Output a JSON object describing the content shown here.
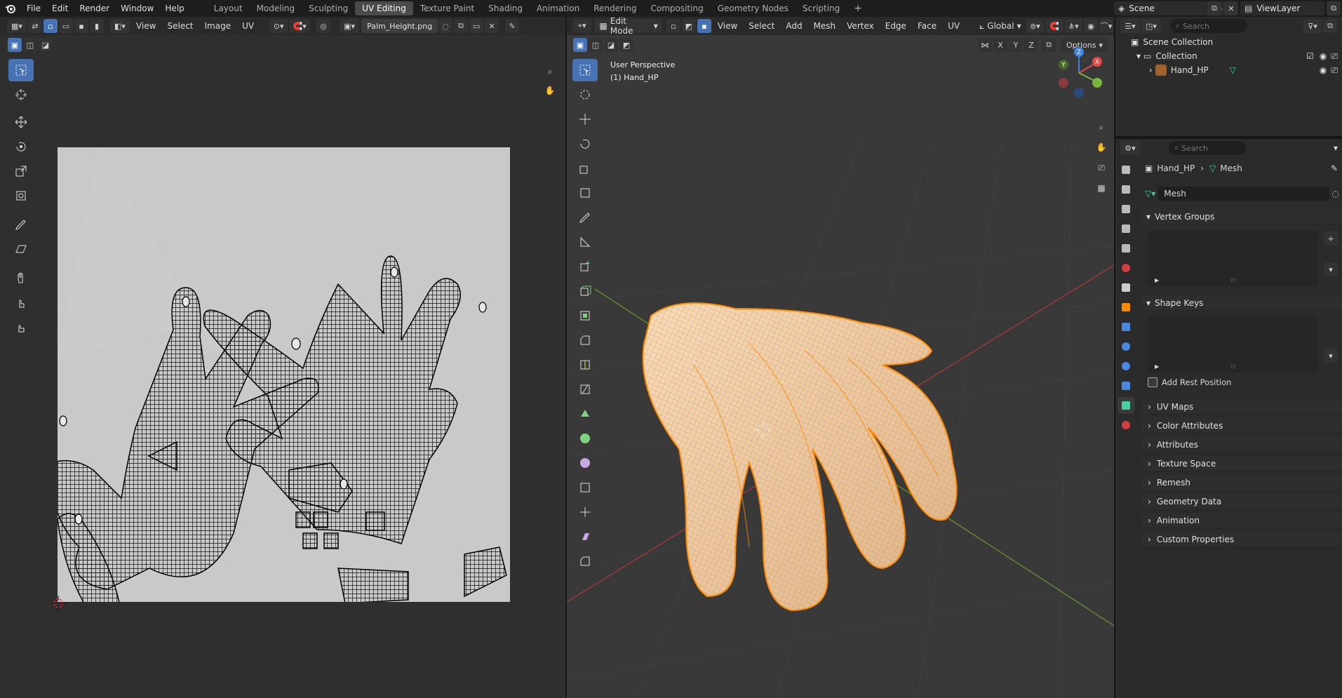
{
  "app": {
    "logo": "blender-icon"
  },
  "menu": [
    "File",
    "Edit",
    "Render",
    "Window",
    "Help"
  ],
  "workspaces": [
    "Layout",
    "Modeling",
    "Sculpting",
    "UV Editing",
    "Texture Paint",
    "Shading",
    "Animation",
    "Rendering",
    "Compositing",
    "Geometry Nodes",
    "Scripting"
  ],
  "workspace_add": "+",
  "active_workspace": "UV Editing",
  "scene": {
    "label": "Scene"
  },
  "view_layer": {
    "label": "ViewLayer"
  },
  "uv_editor": {
    "menus": [
      "View",
      "Select",
      "Image",
      "UV"
    ],
    "image_name": "Palm_Height.png"
  },
  "viewport": {
    "mode": "Edit Mode",
    "menus": [
      "View",
      "Select",
      "Add",
      "Mesh",
      "Vertex",
      "Edge",
      "Face",
      "UV"
    ],
    "transform_orientation": "Global",
    "axes_toggle": [
      "X",
      "Y",
      "Z"
    ],
    "options_label": "Options",
    "overlay_title": "User Perspective",
    "overlay_object": "(1) Hand_HP",
    "gizmo_axes": [
      "X",
      "Y",
      "Z"
    ]
  },
  "outliner": {
    "search_placeholder": "Search",
    "scene_collection": "Scene Collection",
    "collection": "Collection",
    "object": "Hand_HP"
  },
  "properties": {
    "search_placeholder": "Search",
    "breadcrumb_object": "Hand_HP",
    "breadcrumb_separator": "›",
    "breadcrumb_data": "Mesh",
    "mesh_name": "Mesh",
    "panels": {
      "vertex_groups": "Vertex Groups",
      "shape_keys": "Shape Keys",
      "add_rest_position": "Add Rest Position",
      "collapsed": [
        "UV Maps",
        "Color Attributes",
        "Attributes",
        "Texture Space",
        "Remesh",
        "Geometry Data",
        "Animation",
        "Custom Properties"
      ]
    }
  },
  "colors": {
    "accent": "#4772b3",
    "mesh_orange": "#ff8a00",
    "hand_skin": "#e7c8a6",
    "axis_x": "#e34a4a",
    "axis_y": "#7ab53b",
    "axis_z": "#3b82e3"
  }
}
